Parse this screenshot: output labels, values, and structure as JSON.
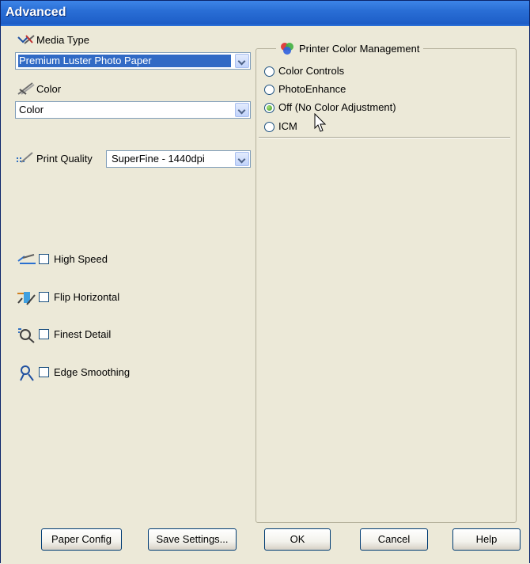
{
  "window": {
    "title": "Advanced"
  },
  "left": {
    "media_type": {
      "label": "Media Type",
      "value": "Premium Luster Photo Paper"
    },
    "color": {
      "label": "Color",
      "value": "Color"
    },
    "print_quality": {
      "label": "Print Quality",
      "value": "SuperFine - 1440dpi"
    },
    "options": [
      {
        "label": "High Speed",
        "checked": false
      },
      {
        "label": "Flip Horizontal",
        "checked": false
      },
      {
        "label": "Finest Detail",
        "checked": false
      },
      {
        "label": "Edge Smoothing",
        "checked": false
      }
    ]
  },
  "color_management": {
    "title": "Printer Color Management",
    "options": [
      {
        "label": "Color Controls",
        "selected": false
      },
      {
        "label": "PhotoEnhance",
        "selected": false
      },
      {
        "label": "Off (No Color Adjustment)",
        "selected": true
      },
      {
        "label": "ICM",
        "selected": false
      }
    ]
  },
  "buttons": {
    "paper_config": "Paper Config",
    "save_settings": "Save Settings...",
    "ok": "OK",
    "cancel": "Cancel",
    "help": "Help"
  },
  "colors": {
    "titlebar": "#2a6fd6",
    "face": "#ece9d8",
    "selection": "#316ac5"
  }
}
